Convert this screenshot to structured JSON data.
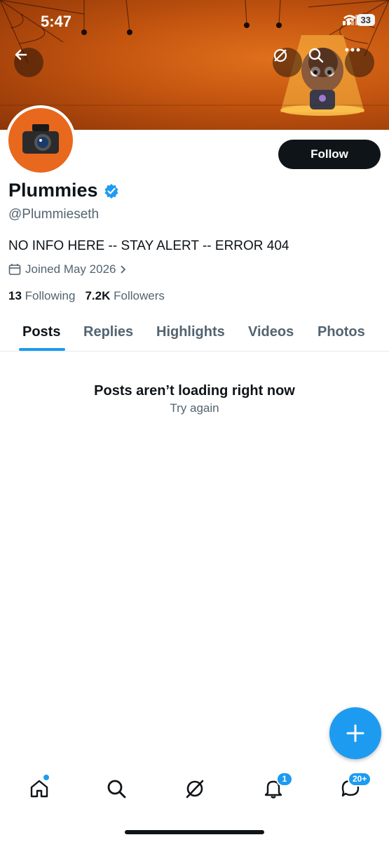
{
  "status_bar": {
    "time": "5:47",
    "battery": "33"
  },
  "profile": {
    "name": "Plummies",
    "handle": "@Plummieseth",
    "bio": "NO INFO HERE -- STAY ALERT -- ERROR 404",
    "joined": "Joined May 2026",
    "following_count": "13",
    "following_label": "Following",
    "followers_count": "7.2K",
    "followers_label": "Followers",
    "follow_button": "Follow"
  },
  "tabs": [
    {
      "label": "Posts",
      "active": true
    },
    {
      "label": "Replies"
    },
    {
      "label": "Highlights"
    },
    {
      "label": "Videos"
    },
    {
      "label": "Photos"
    }
  ],
  "empty_state": {
    "title": "Posts aren’t loading right now",
    "action": "Try again"
  },
  "bottom_nav": {
    "items": [
      "home-icon",
      "search-icon",
      "grok-icon",
      "notifications-icon",
      "messages-icon"
    ],
    "notifications_badge": "1",
    "messages_badge": "20+"
  },
  "colors": {
    "accent": "#1d9bf0",
    "text": "#0f1419",
    "secondary": "#536471",
    "banner": "#c2540f"
  }
}
